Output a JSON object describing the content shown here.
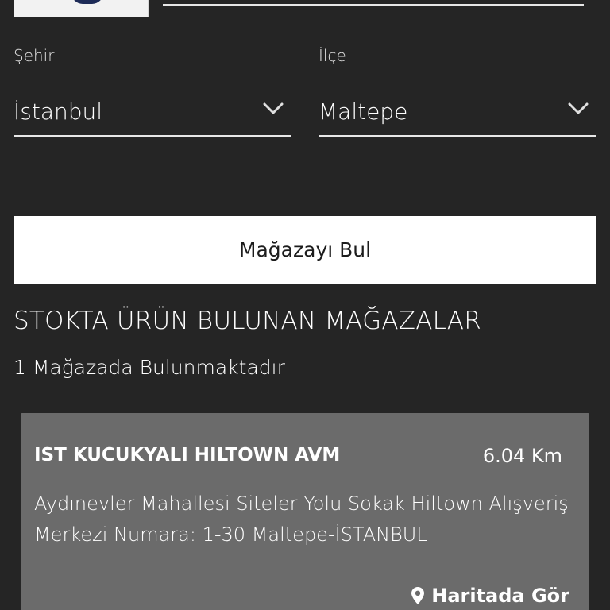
{
  "form": {
    "city_label": "Şehir",
    "city_value": "İstanbul",
    "district_label": "İlçe",
    "district_value": "Maltepe",
    "find_button": "Mağazayı Bul"
  },
  "results": {
    "title": "STOKTA ÜRÜN BULUNAN MAĞAZALAR",
    "count_text": "1 Mağazada Bulunmaktadır",
    "stores": [
      {
        "name": "IST KUCUKYALI HILTOWN AVM",
        "distance": "6.04 Km",
        "address": "Aydınevler Mahallesi Siteler Yolu Sokak Hiltown Alışveriş Merkezi Numara: 1-30  Maltepe-İSTANBUL",
        "map_link": "Haritada Gör"
      }
    ]
  },
  "icons": {
    "chevron": "chevron-down-icon",
    "pin": "map-pin-icon"
  },
  "colors": {
    "background": "#252525",
    "card": "#6b6b6b",
    "button": "#ffffff"
  }
}
